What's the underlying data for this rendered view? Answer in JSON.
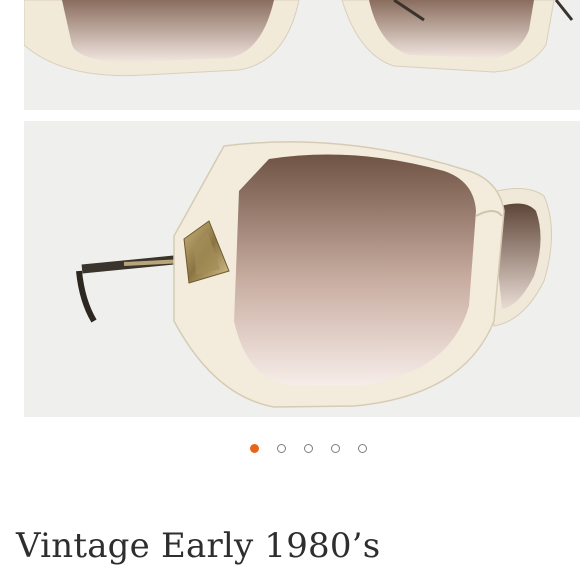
{
  "carousel": {
    "photos": [
      {
        "icon": "sunglasses-front-photo"
      },
      {
        "icon": "sunglasses-side-photo"
      }
    ],
    "dots": [
      {
        "active": true
      },
      {
        "active": false
      },
      {
        "active": false
      },
      {
        "active": false
      },
      {
        "active": false
      }
    ],
    "active_color": "#e8641b"
  },
  "listing": {
    "title": "Vintage Early 1980’s"
  }
}
